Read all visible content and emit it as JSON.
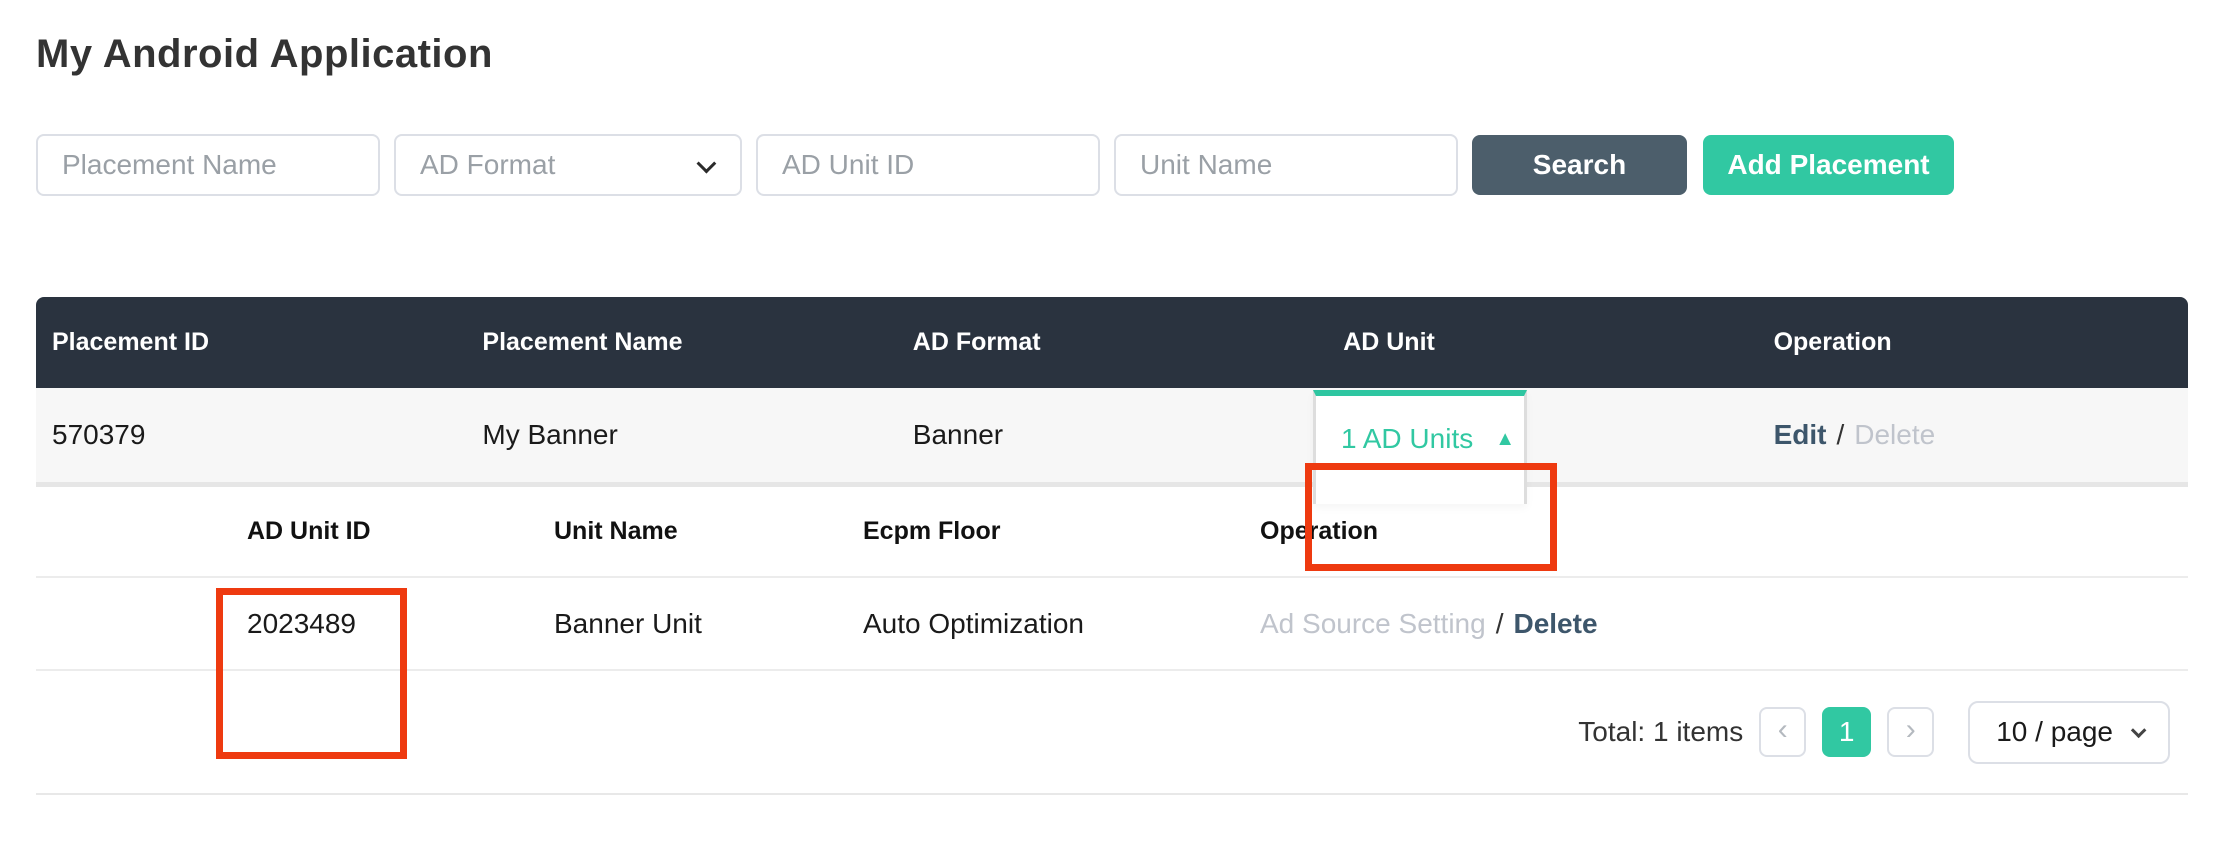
{
  "page": {
    "title": "My Android Application"
  },
  "filters": {
    "placement_name_placeholder": "Placement Name",
    "ad_format_placeholder": "AD Format",
    "ad_unit_id_placeholder": "AD Unit ID",
    "unit_name_placeholder": "Unit Name",
    "search_label": "Search",
    "add_placement_label": "Add Placement"
  },
  "table": {
    "headers": [
      "Placement ID",
      "Placement Name",
      "AD Format",
      "AD Unit",
      "Operation"
    ],
    "row": {
      "placement_id": "570379",
      "placement_name": "My Banner",
      "ad_format": "Banner",
      "ad_unit_toggle_label": "1 AD Units",
      "ad_unit_collapse_icon": "▲",
      "op_edit": "Edit",
      "op_separator": "/",
      "op_delete": "Delete"
    },
    "subtable": {
      "headers": [
        "AD Unit ID",
        "Unit Name",
        "Ecpm Floor",
        "Operation"
      ],
      "row": {
        "ad_unit_id": "2023489",
        "unit_name": "Banner Unit",
        "ecpm_floor": "Auto Optimization",
        "op_ad_source_setting": "Ad Source Setting",
        "op_separator": "/",
        "op_delete": "Delete"
      }
    }
  },
  "pagination": {
    "total_label": "Total: 1 items",
    "prev_icon": "‹",
    "current_page": "1",
    "next_icon": "›",
    "page_size_label": "10 / page"
  },
  "colors": {
    "accent_teal": "#31c8a2",
    "table_header_dark": "#2a333f",
    "search_button": "#4c5e6b",
    "annotation_red": "#ee3a10",
    "link_slate": "#3d566b",
    "disabled_gray": "#c0c4cc"
  }
}
